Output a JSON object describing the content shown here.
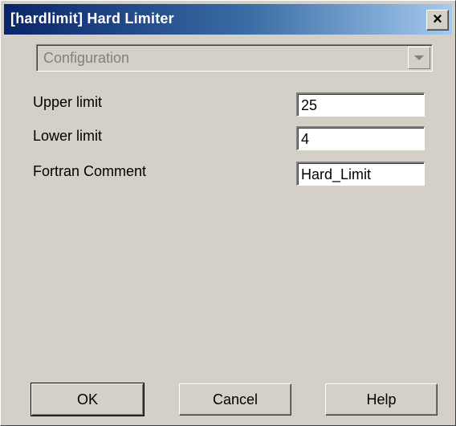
{
  "window": {
    "title": "[hardlimit] Hard Limiter",
    "close_glyph": "×"
  },
  "combo": {
    "value": "Configuration",
    "arrow_icon": "chevron-down-icon"
  },
  "fields": [
    {
      "label": "Upper limit",
      "value": "25"
    },
    {
      "label": "Lower limit",
      "value": "4"
    },
    {
      "label": "Fortran Comment",
      "value": "Hard_Limit"
    }
  ],
  "buttons": {
    "ok_label": "OK",
    "cancel_label": "Cancel",
    "help_label": "Help"
  },
  "colors": {
    "title_start": "#0a246a",
    "title_end": "#a6caf0",
    "face": "#d4d0c8"
  }
}
